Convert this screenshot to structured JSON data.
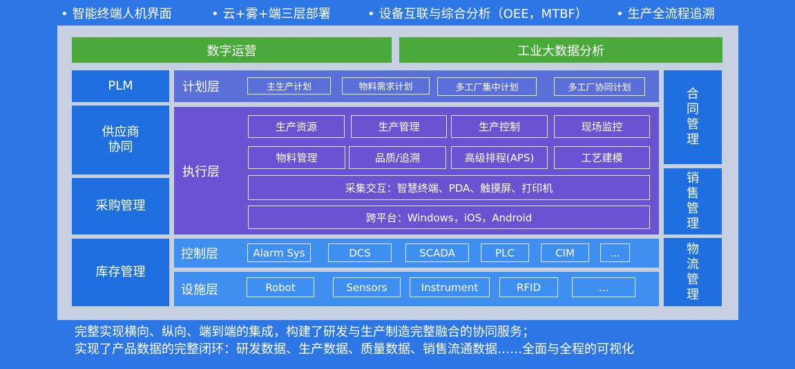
{
  "features": [
    "智能终端人机界面",
    "云+雾+端三层部署",
    "设备互联与综合分析（OEE，MTBF）",
    "生产全流程追溯"
  ],
  "bullet": "•",
  "top_bars": {
    "left": "数字运营",
    "right": "工业大数据分析"
  },
  "left_column": {
    "plm": "PLM",
    "supplier": "供应商\n协同",
    "procurement": "采购管理",
    "inventory": "库存管理"
  },
  "right_column": {
    "contract": "合同管理",
    "sales": "销售管理",
    "logistics": "物流管理"
  },
  "plan_layer": {
    "title": "计划层",
    "items": [
      "主生产计划",
      "物料需求计划",
      "多工厂集中计划",
      "多工厂协同计划"
    ]
  },
  "exec_layer": {
    "title": "执行层",
    "row1": [
      "生产资源",
      "生产管理",
      "生产控制",
      "现场监控"
    ],
    "row2": [
      "物料管理",
      "品质/追溯",
      "高级排程(APS)",
      "工艺建模"
    ],
    "collect": "采集交互：智慧终端、PDA、触摸屏、打印机",
    "platform": "跨平台：Windows，iOS，Android"
  },
  "control_layer": {
    "title": "控制层",
    "items": [
      "Alarm Sys",
      "DCS",
      "SCADA",
      "PLC",
      "CIM",
      "..."
    ]
  },
  "facility_layer": {
    "title": "设施层",
    "items": [
      "Robot",
      "Sensors",
      "Instrument",
      "RFID",
      "..."
    ]
  },
  "footer": {
    "line1": "完整实现横向、纵向、端到端的集成，构建了研发与生产制造完整融合的协同服务；",
    "line2": "实现了产品数据的完整闭环：研发数据、生产数据、质量数据、销售流通数据……全面与全程的可视化"
  }
}
